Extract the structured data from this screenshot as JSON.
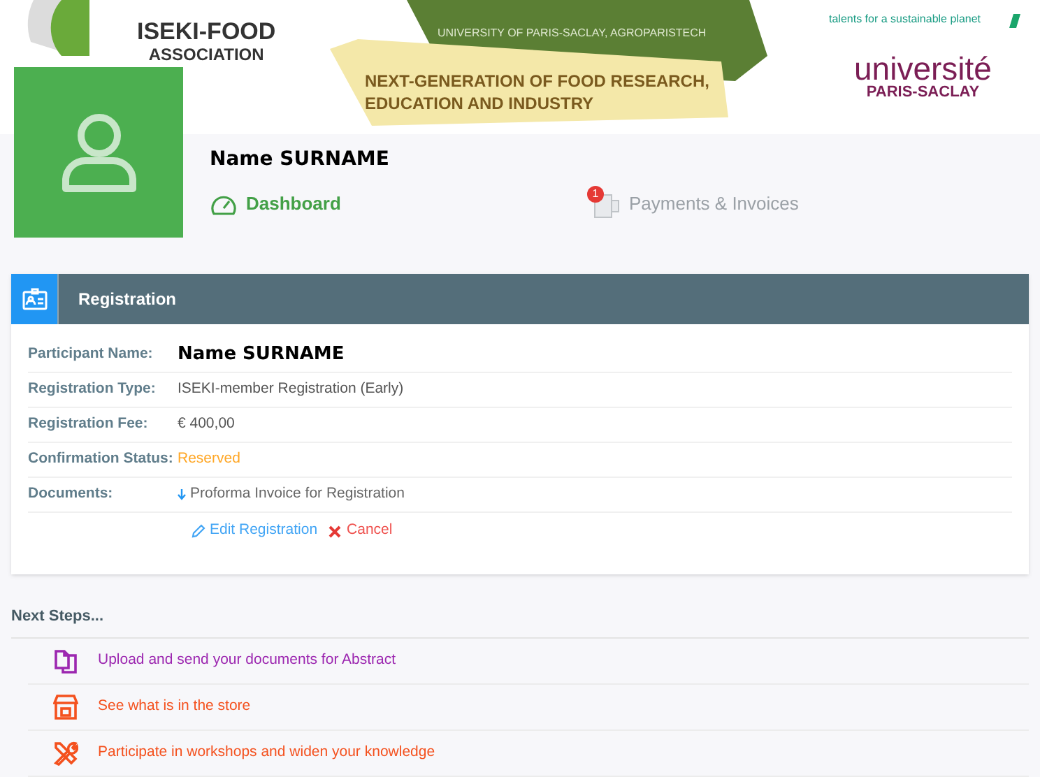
{
  "header": {
    "association": [
      "ISEKI-FOOD",
      "ASSOCIATION"
    ],
    "banner_top": "UNIVERSITY OF PARIS-SACLAY, AGROPARISTECH",
    "banner_main": [
      "NEXT-GENERATION OF FOOD RESEARCH,",
      "EDUCATION AND INDUSTRY"
    ],
    "tagline": "talents for a sustainable planet",
    "university": [
      "université",
      "PARIS-SACLAY"
    ]
  },
  "profile": {
    "name": "Name SURNAME"
  },
  "nav": [
    {
      "label": "Dashboard",
      "selected": true
    },
    {
      "label": "Payments & Invoices",
      "selected": false,
      "badge": "1"
    }
  ],
  "registration": {
    "title": "Registration",
    "rows": [
      {
        "label": "Participant Name:",
        "value": "Name SURNAME",
        "kind": "name"
      },
      {
        "label": "Registration Type:",
        "value": "ISEKI-member Registration (Early)",
        "kind": "text"
      },
      {
        "label": "Registration Fee:",
        "value": "€ 400,00",
        "kind": "text"
      },
      {
        "label": "Confirmation Status:",
        "value": "Reserved",
        "kind": "status"
      },
      {
        "label": "Documents:",
        "value": "Proforma Invoice for Registration",
        "kind": "document"
      }
    ],
    "actions": [
      {
        "label": "Edit Registration",
        "kind": "edit"
      },
      {
        "label": "Cancel",
        "kind": "cancel"
      }
    ]
  },
  "next_steps": {
    "title": "Next Steps...",
    "items": [
      {
        "label": "Upload and send your documents for Abstract",
        "kind": "documents",
        "color": "#9c27b0"
      },
      {
        "label": "See what is in the store",
        "kind": "store",
        "color": "#f4511e"
      },
      {
        "label": "Participate in workshops and widen your knowledge",
        "kind": "tools",
        "color": "#f4511e"
      }
    ]
  }
}
